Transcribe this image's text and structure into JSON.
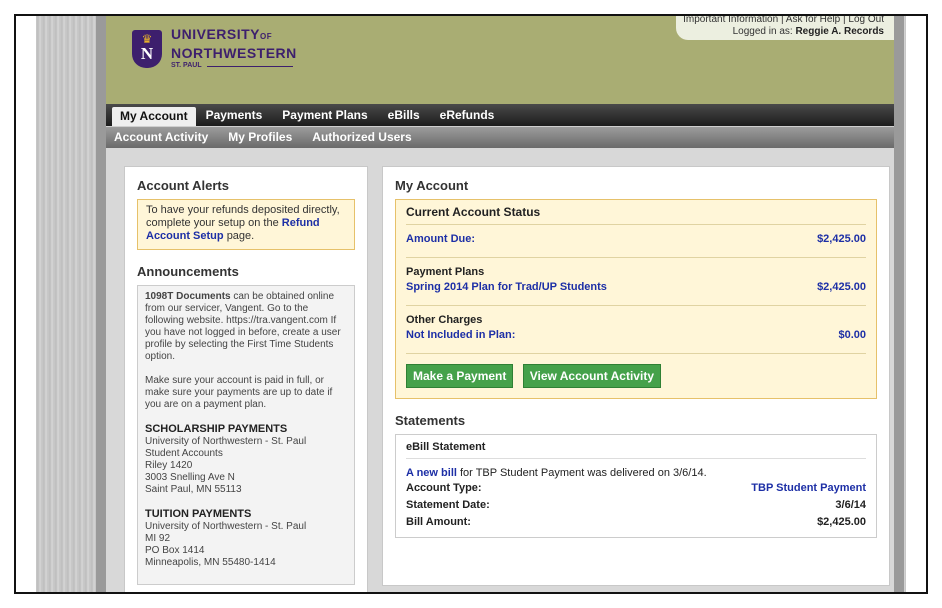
{
  "header": {
    "top_links": [
      "Important Information",
      "Ask for Help",
      "Log Out"
    ],
    "logged_in_prefix": "Logged in as:",
    "logged_in_user": "Reggie A. Records",
    "logo": {
      "line1": "UNIVERSITY",
      "line1_small": "OF",
      "line2": "NORTHWESTERN",
      "line3": "ST. PAUL"
    }
  },
  "nav": {
    "primary": [
      "My Account",
      "Payments",
      "Payment Plans",
      "eBills",
      "eRefunds"
    ],
    "secondary": [
      "Account Activity",
      "My Profiles",
      "Authorized Users"
    ]
  },
  "alerts": {
    "title": "Account Alerts",
    "text_before": "To have your refunds deposited directly, complete your setup on the",
    "link": "Refund Account Setup",
    "text_after": "page."
  },
  "announcements": {
    "title": "Announcements",
    "p1_bold": "1098T Documents",
    "p1_text": "can be obtained online from our servicer, Vangent. Go to the following website. https://tra.vangent.com If you have not logged in before, create a user profile by selecting the First Time Students option.",
    "p2": "Make sure your account is paid in full, or make sure your payments are up to date if you are on a payment plan.",
    "scholarship_title": "SCHOLARSHIP PAYMENTS",
    "scholarship_lines": [
      "University of Northwestern - St. Paul",
      "Student Accounts",
      "Riley 1420",
      "3003 Snelling Ave N",
      "Saint Paul, MN 55113"
    ],
    "tuition_title": "TUITION PAYMENTS",
    "tuition_lines": [
      "University of Northwestern - St. Paul",
      "MI 92",
      "PO Box 1414",
      "Minneapolis, MN 55480-1414"
    ]
  },
  "account": {
    "title": "My Account",
    "status_title": "Current Account Status",
    "amount_due_label": "Amount Due:",
    "amount_due": "$2,425.00",
    "plans_title": "Payment Plans",
    "plan_name": "Spring 2014 Plan for Trad/UP Students",
    "plan_amount": "$2,425.00",
    "other_title": "Other Charges",
    "other_label": "Not Included in Plan:",
    "other_amount": "$0.00",
    "btn_pay": "Make a Payment",
    "btn_activity": "View Account Activity"
  },
  "statements": {
    "title": "Statements",
    "ebill_title": "eBill Statement",
    "new_bill_link": "A new bill",
    "new_bill_text": "for TBP Student Payment was delivered on 3/6/14.",
    "account_type_label": "Account Type:",
    "account_type": "TBP Student Payment",
    "statement_date_label": "Statement Date:",
    "statement_date": "3/6/14",
    "bill_amount_label": "Bill Amount:",
    "bill_amount": "$2,425.00"
  }
}
